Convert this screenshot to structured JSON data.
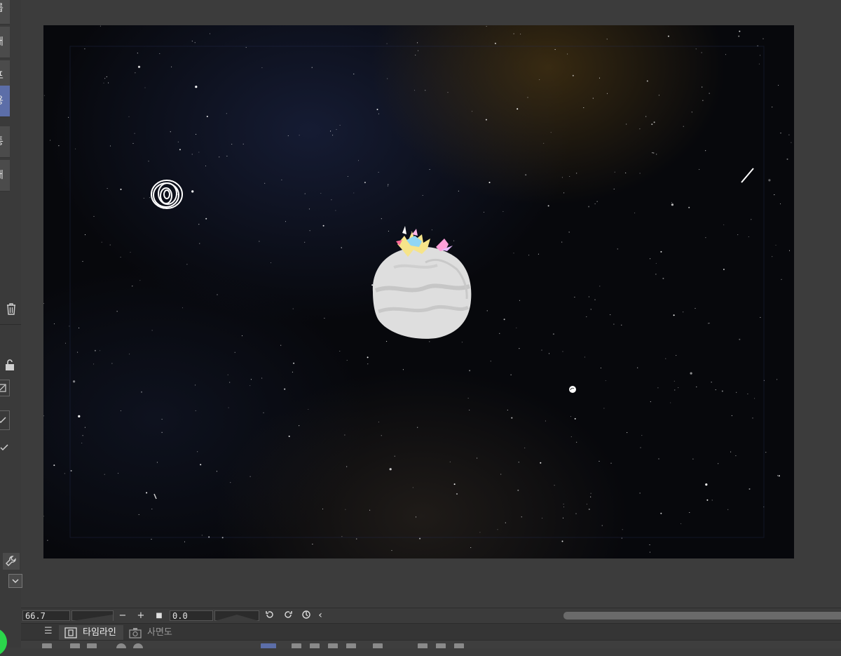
{
  "app": {
    "left_menu": [
      {
        "label": "룹",
        "active": false
      },
      {
        "label": "애",
        "active": false
      },
      {
        "label": "프",
        "active": false
      },
      {
        "label": "용",
        "active": true
      },
      {
        "label": "통",
        "active": false
      },
      {
        "label": "애",
        "active": false
      }
    ],
    "left_icons": [
      "trash-icon",
      "lock-icon",
      "layer-icon",
      "checkbox-icon",
      "check-icon",
      "wrench-icon",
      "dropdown-icon"
    ]
  },
  "control_bar": {
    "zoom_value": "66.7",
    "minus_label": "−",
    "plus_label": "+",
    "stop_label": "■",
    "rotation_value": "0.0",
    "rotate_left_icon": "rotate-ccw-icon",
    "rotate_right_icon": "rotate-cw-icon",
    "reset_icon": "reset-rotation-icon",
    "collapse_label": "‹"
  },
  "tabs": {
    "menu_label": "☰",
    "timeline_label": "타임라인",
    "side_view_label": "사면도"
  },
  "colors": {
    "accent": "#5c6ea8",
    "panel_bg": "#3c3c3c",
    "canvas_bg": "#07080c"
  }
}
